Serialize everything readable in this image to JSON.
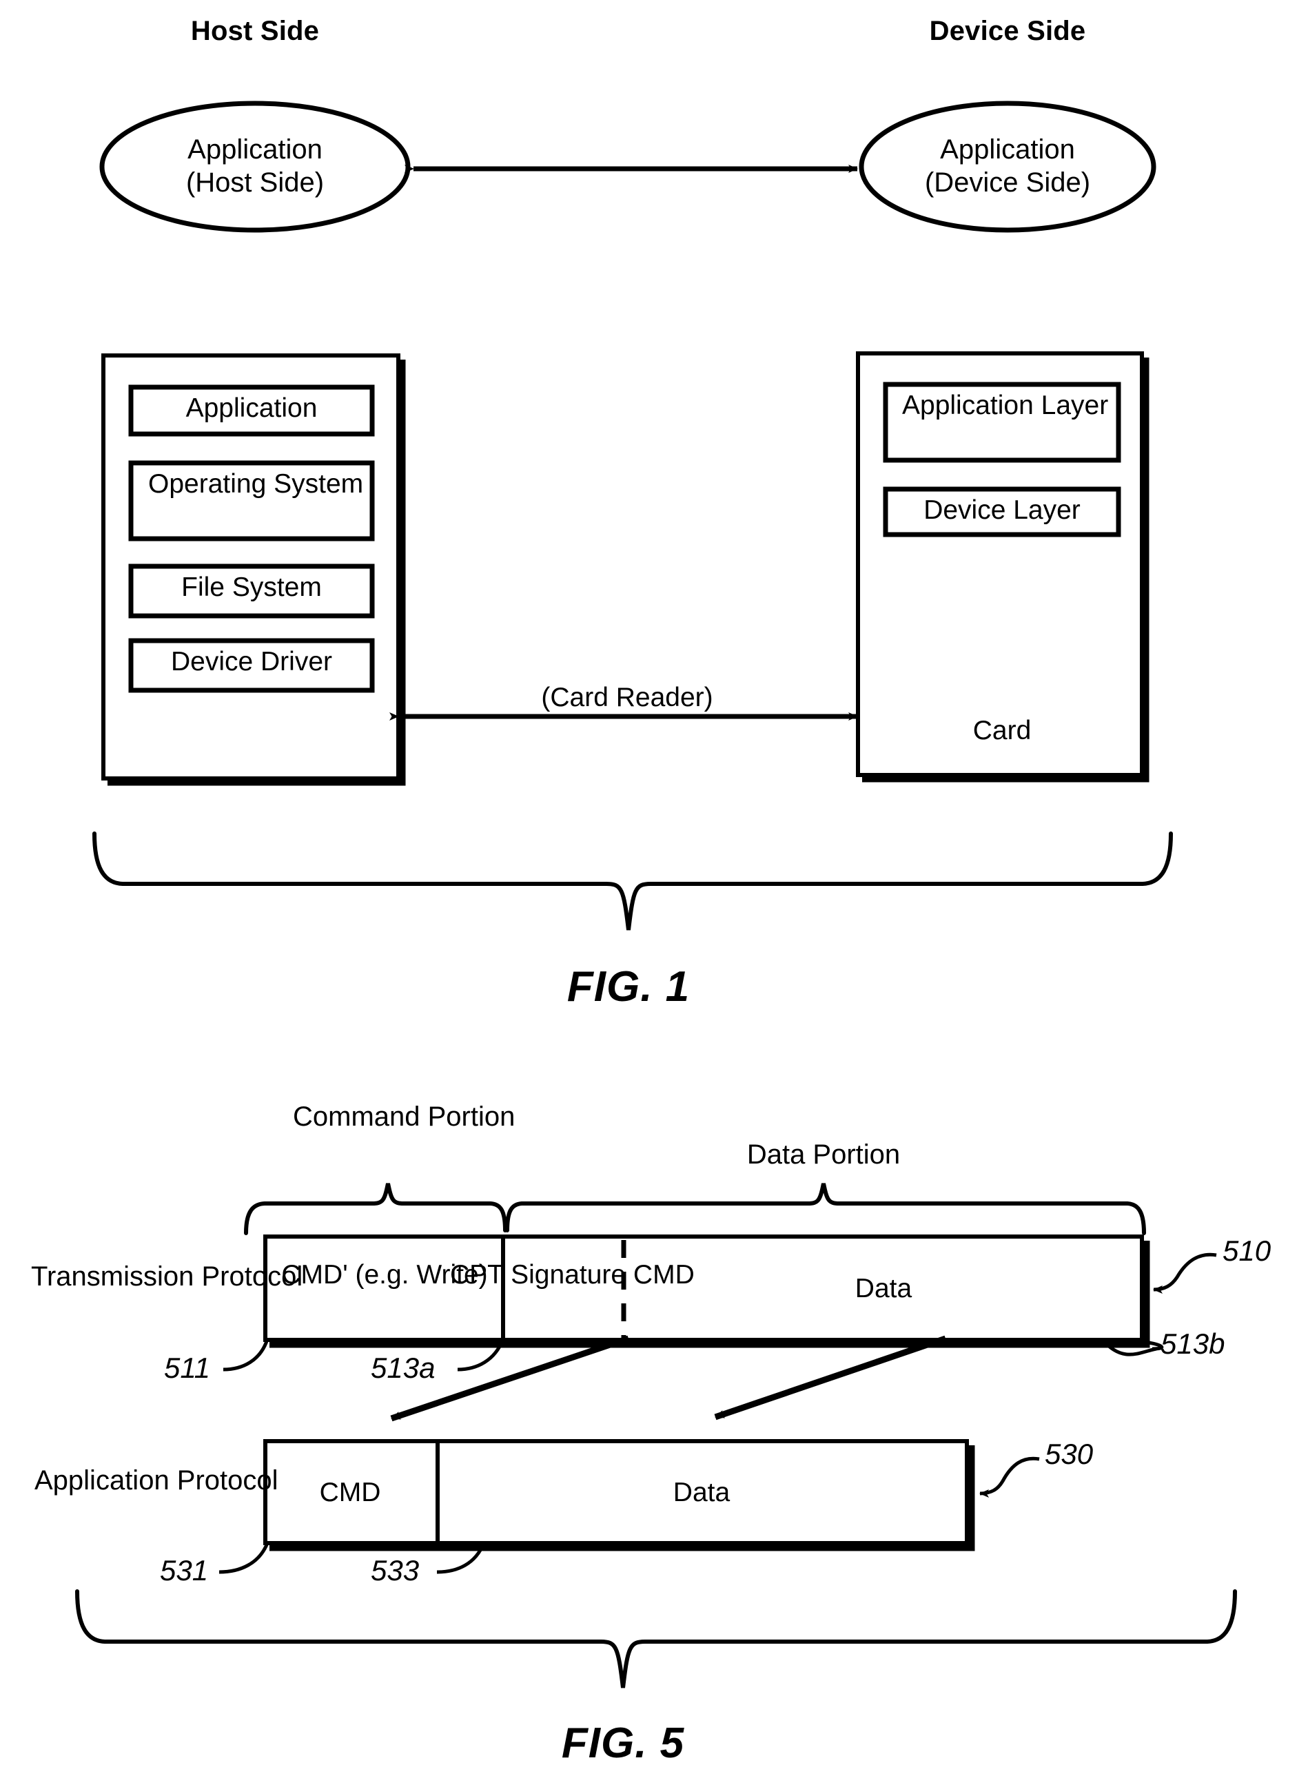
{
  "figure1": {
    "host_title": "Host Side",
    "device_title": "Device Side",
    "host_ellipse": {
      "line1": "Application",
      "line2": "(Host Side)"
    },
    "device_ellipse": {
      "line1": "Application",
      "line2": "(Device Side)"
    },
    "host_stack": [
      {
        "label": "Application"
      },
      {
        "label": "Operating System"
      },
      {
        "label": "File System"
      },
      {
        "label": "Device Driver"
      }
    ],
    "device_stack": [
      {
        "label": "Application Layer"
      },
      {
        "label": "Device Layer"
      }
    ],
    "card_label": "Card",
    "link_label": "(Card Reader)",
    "caption": "FIG. 1"
  },
  "figure5": {
    "brace_labels": {
      "command_portion": "Command Portion",
      "data_portion": "Data Portion"
    },
    "rows": [
      {
        "name": "transmission",
        "protocol_label": "Transmission Protocol",
        "cells": [
          {
            "label": "CMD' (e.g. Write)"
          },
          {
            "label": "CPT Signature CMD"
          },
          {
            "label": "Data"
          }
        ],
        "ref_right": "510"
      },
      {
        "name": "application",
        "protocol_label": "Application Protocol",
        "cells": [
          {
            "label": "CMD"
          },
          {
            "label": "Data"
          }
        ],
        "ref_right": "530"
      }
    ],
    "refnums": {
      "r511": "511",
      "r513a": "513a",
      "r513b": "513b",
      "r510": "510",
      "r531": "531",
      "r533": "533",
      "r530": "530"
    },
    "caption": "FIG. 5"
  },
  "colors": {
    "ink": "#000000",
    "paper": "#ffffff"
  }
}
